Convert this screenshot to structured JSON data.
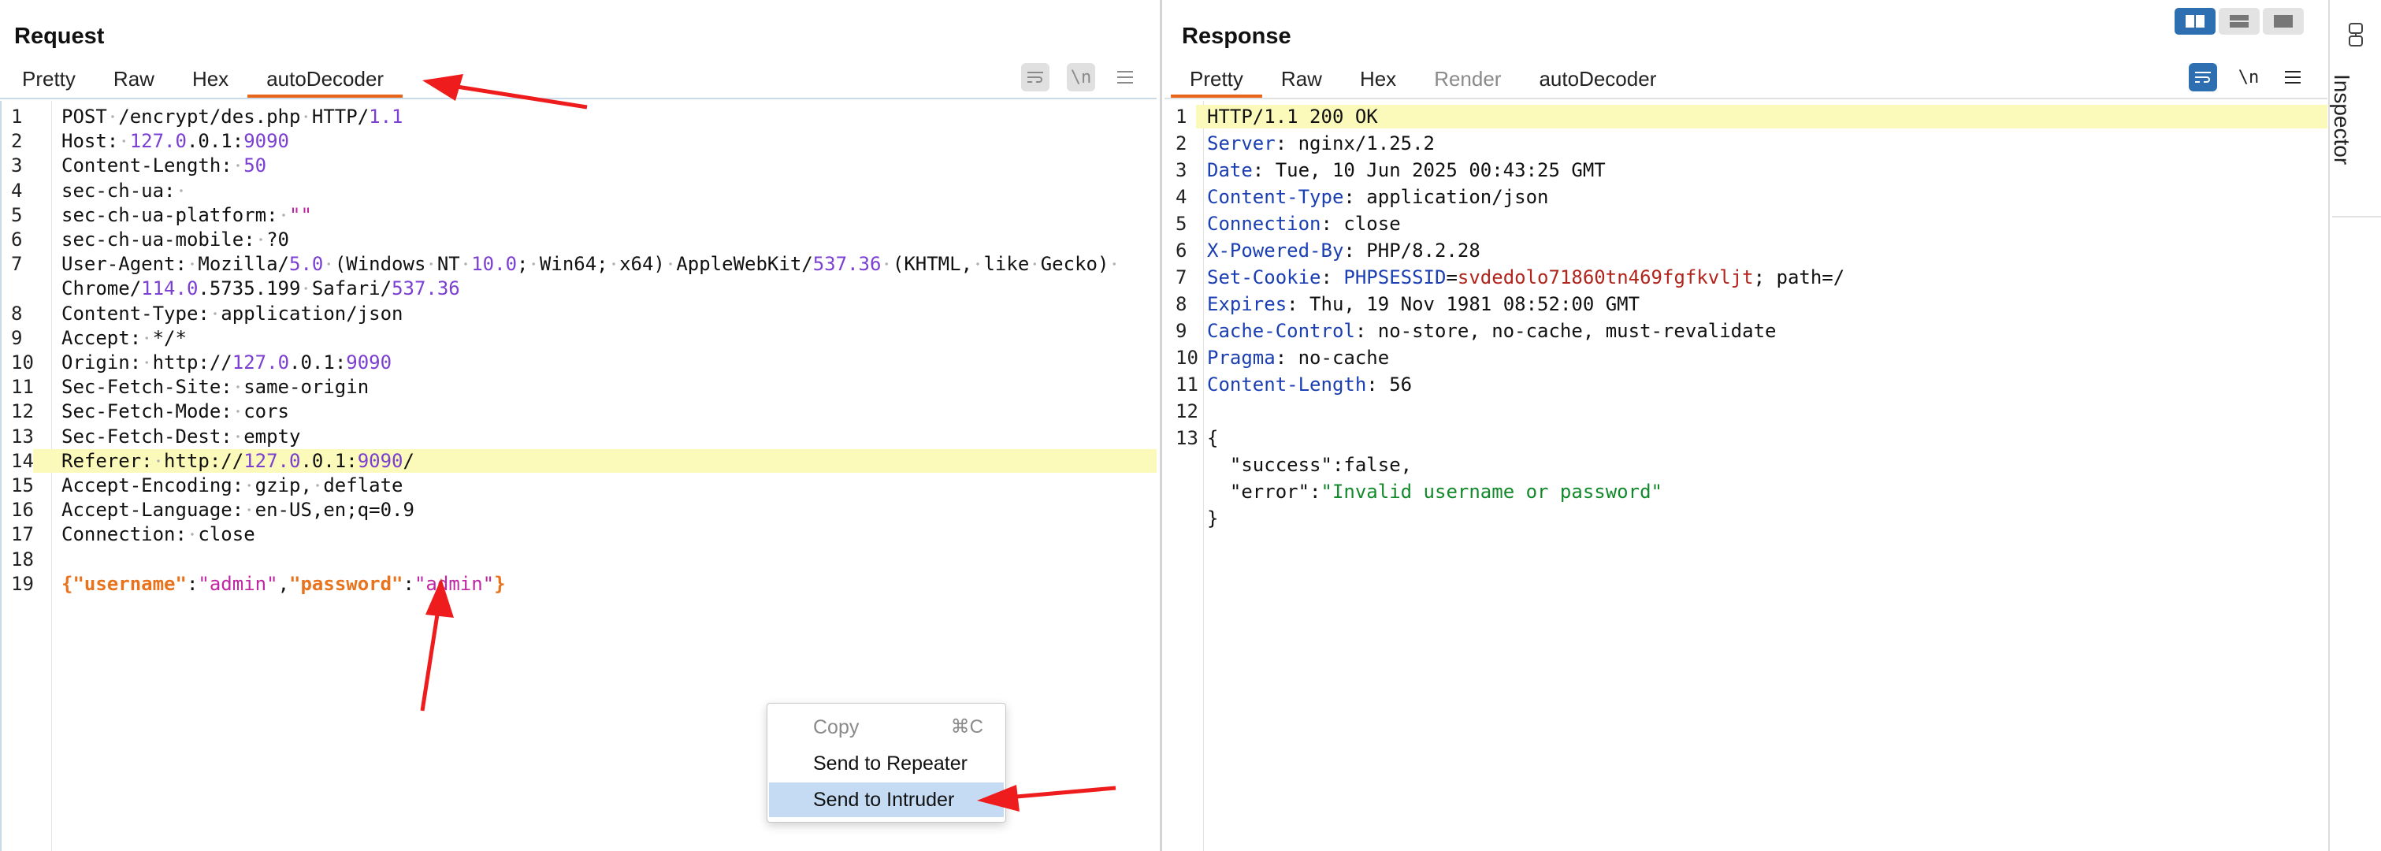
{
  "request": {
    "title": "Request",
    "tabs": [
      "Pretty",
      "Raw",
      "Hex",
      "autoDecoder"
    ],
    "active_tab": "autoDecoder",
    "tools": {
      "wrap_icon": "wrap-lines-icon",
      "newline_label": "\\n",
      "menu_icon": "hamburger-menu-icon"
    },
    "lines": [
      {
        "n": "1",
        "segs": [
          [
            "POST",
            ""
          ],
          [
            " ",
            "dot"
          ],
          [
            "/encrypt/des.php",
            ""
          ],
          [
            " ",
            "dot"
          ],
          [
            "HTTP/",
            ""
          ],
          [
            "1.1",
            "num"
          ]
        ]
      },
      {
        "n": "2",
        "segs": [
          [
            "Host:",
            ""
          ],
          [
            " ",
            "dot"
          ],
          [
            "127.0",
            "num"
          ],
          [
            ".0.1:",
            ""
          ],
          [
            "9090",
            "num"
          ]
        ]
      },
      {
        "n": "3",
        "segs": [
          [
            "Content-Length:",
            ""
          ],
          [
            " ",
            "dot"
          ],
          [
            "50",
            "num"
          ]
        ]
      },
      {
        "n": "4",
        "segs": [
          [
            "sec-ch-ua:",
            ""
          ],
          [
            " ",
            "dot"
          ]
        ]
      },
      {
        "n": "5",
        "segs": [
          [
            "sec-ch-ua-platform:",
            ""
          ],
          [
            " ",
            "dot"
          ],
          [
            "\"\"",
            "str"
          ]
        ]
      },
      {
        "n": "6",
        "segs": [
          [
            "sec-ch-ua-mobile:",
            ""
          ],
          [
            " ",
            "dot"
          ],
          [
            "?0",
            ""
          ]
        ]
      },
      {
        "n": "7",
        "segs": [
          [
            "User-Agent:",
            ""
          ],
          [
            " ",
            "dot"
          ],
          [
            "Mozilla/",
            ""
          ],
          [
            "5.0",
            "num"
          ],
          [
            " ",
            "dot"
          ],
          [
            "(Windows",
            ""
          ],
          [
            " ",
            "dot"
          ],
          [
            "NT",
            ""
          ],
          [
            " ",
            "dot"
          ],
          [
            "10.0",
            "num"
          ],
          [
            ";",
            ""
          ],
          [
            " ",
            "dot"
          ],
          [
            "Win64;",
            ""
          ],
          [
            " ",
            "dot"
          ],
          [
            "x64)",
            ""
          ],
          [
            " ",
            "dot"
          ],
          [
            "AppleWebKit/",
            ""
          ],
          [
            "537.36",
            "num"
          ],
          [
            " ",
            "dot"
          ],
          [
            "(KHTML,",
            ""
          ],
          [
            " ",
            "dot"
          ],
          [
            "like",
            ""
          ],
          [
            " ",
            "dot"
          ],
          [
            "Gecko)",
            ""
          ],
          [
            " ",
            "dot"
          ]
        ]
      },
      {
        "n": "",
        "segs": [
          [
            "Chrome/",
            ""
          ],
          [
            "114.0",
            "num"
          ],
          [
            ".5735.199",
            ""
          ],
          [
            " ",
            "dot"
          ],
          [
            "Safari/",
            ""
          ],
          [
            "537.36",
            "num"
          ]
        ]
      },
      {
        "n": "8",
        "segs": [
          [
            "Content-Type:",
            ""
          ],
          [
            " ",
            "dot"
          ],
          [
            "application/json",
            ""
          ]
        ]
      },
      {
        "n": "9",
        "segs": [
          [
            "Accept:",
            ""
          ],
          [
            " ",
            "dot"
          ],
          [
            "*/*",
            ""
          ]
        ]
      },
      {
        "n": "10",
        "segs": [
          [
            "Origin:",
            ""
          ],
          [
            " ",
            "dot"
          ],
          [
            "http://",
            ""
          ],
          [
            "127.0",
            "num"
          ],
          [
            ".0.1:",
            ""
          ],
          [
            "9090",
            "num"
          ]
        ]
      },
      {
        "n": "11",
        "segs": [
          [
            "Sec-Fetch-Site:",
            ""
          ],
          [
            " ",
            "dot"
          ],
          [
            "same-origin",
            ""
          ]
        ]
      },
      {
        "n": "12",
        "segs": [
          [
            "Sec-Fetch-Mode:",
            ""
          ],
          [
            " ",
            "dot"
          ],
          [
            "cors",
            ""
          ]
        ]
      },
      {
        "n": "13",
        "segs": [
          [
            "Sec-Fetch-Dest:",
            ""
          ],
          [
            " ",
            "dot"
          ],
          [
            "empty",
            ""
          ]
        ]
      },
      {
        "n": "14",
        "hl": true,
        "segs": [
          [
            "Referer:",
            ""
          ],
          [
            " ",
            "dot"
          ],
          [
            "http://",
            ""
          ],
          [
            "127.0",
            "num"
          ],
          [
            ".0.1:",
            ""
          ],
          [
            "9090",
            "num"
          ],
          [
            "/",
            ""
          ]
        ]
      },
      {
        "n": "15",
        "segs": [
          [
            "Accept-Encoding:",
            ""
          ],
          [
            " ",
            "dot"
          ],
          [
            "gzip,",
            ""
          ],
          [
            " ",
            "dot"
          ],
          [
            "deflate",
            ""
          ]
        ]
      },
      {
        "n": "16",
        "segs": [
          [
            "Accept-Language:",
            ""
          ],
          [
            " ",
            "dot"
          ],
          [
            "en-US,en;q=0.9",
            ""
          ]
        ]
      },
      {
        "n": "17",
        "segs": [
          [
            "Connection:",
            ""
          ],
          [
            " ",
            "dot"
          ],
          [
            "close",
            ""
          ]
        ]
      },
      {
        "n": "18",
        "segs": []
      },
      {
        "n": "19",
        "segs": [
          [
            "{",
            "key"
          ],
          [
            "\"username\"",
            "key"
          ],
          [
            ":",
            ""
          ],
          [
            "\"admin\"",
            "str"
          ],
          [
            ",",
            ""
          ],
          [
            "\"password\"",
            "key"
          ],
          [
            ":",
            ""
          ],
          [
            "\"admin\"",
            "str"
          ],
          [
            "}",
            "key"
          ]
        ]
      }
    ]
  },
  "response": {
    "title": "Response",
    "tabs": [
      "Pretty",
      "Raw",
      "Hex",
      "Render",
      "autoDecoder"
    ],
    "active_tab": "Pretty",
    "disabled_tab": "Render",
    "tools": {
      "wrap_icon": "wrap-lines-icon",
      "newline_label": "\\n",
      "menu_icon": "hamburger-menu-icon"
    },
    "lines": [
      {
        "n": "1",
        "hl": true,
        "segs": [
          [
            "HTTP/1.1 200 OK",
            ""
          ]
        ]
      },
      {
        "n": "2",
        "segs": [
          [
            "Server",
            "hk"
          ],
          [
            ": nginx/1.25.2",
            ""
          ]
        ]
      },
      {
        "n": "3",
        "segs": [
          [
            "Date",
            "hk"
          ],
          [
            ": Tue, 10 Jun 2025 00:43:25 GMT",
            ""
          ]
        ]
      },
      {
        "n": "4",
        "segs": [
          [
            "Content-Type",
            "hk"
          ],
          [
            ": application/json",
            ""
          ]
        ]
      },
      {
        "n": "5",
        "segs": [
          [
            "Connection",
            "hk"
          ],
          [
            ": close",
            ""
          ]
        ]
      },
      {
        "n": "6",
        "segs": [
          [
            "X-Powered-By",
            "hk"
          ],
          [
            ": PHP/8.2.28",
            ""
          ]
        ]
      },
      {
        "n": "7",
        "segs": [
          [
            "Set-Cookie",
            "hk"
          ],
          [
            ": ",
            ""
          ],
          [
            "PHPSESSID",
            "hk"
          ],
          [
            "=",
            ""
          ],
          [
            "svdedolo71860tn469fgfkvljt",
            "cookie"
          ],
          [
            "; path=/",
            ""
          ]
        ]
      },
      {
        "n": "8",
        "segs": [
          [
            "Expires",
            "hk"
          ],
          [
            ": Thu, 19 Nov 1981 08:52:00 GMT",
            ""
          ]
        ]
      },
      {
        "n": "9",
        "segs": [
          [
            "Cache-Control",
            "hk"
          ],
          [
            ": no-store, no-cache, must-revalidate",
            ""
          ]
        ]
      },
      {
        "n": "10",
        "segs": [
          [
            "Pragma",
            "hk"
          ],
          [
            ": no-cache",
            ""
          ]
        ]
      },
      {
        "n": "11",
        "segs": [
          [
            "Content-Length",
            "hk"
          ],
          [
            ": 56",
            ""
          ]
        ]
      },
      {
        "n": "12",
        "segs": []
      },
      {
        "n": "13",
        "segs": [
          [
            "{",
            ""
          ]
        ]
      },
      {
        "n": "",
        "segs": [
          [
            "  \"success\":false,",
            ""
          ]
        ]
      },
      {
        "n": "",
        "segs": [
          [
            "  \"error\":",
            ""
          ],
          [
            "\"Invalid username or password\"",
            "green"
          ]
        ]
      },
      {
        "n": "",
        "segs": [
          [
            "}",
            ""
          ]
        ]
      }
    ]
  },
  "context_menu": {
    "items": [
      {
        "label": "Copy",
        "shortcut": "⌘C",
        "disabled": true
      },
      {
        "label": "Send to Repeater",
        "shortcut": ""
      },
      {
        "label": "Send to Intruder",
        "shortcut": "",
        "selected": true
      }
    ]
  },
  "sidebar": {
    "inspector_label": "Inspector",
    "layout_buttons": [
      "split-horizontal-icon",
      "split-vertical-icon",
      "single-pane-icon"
    ]
  },
  "colors": {
    "accent_tab": "#e8661c",
    "toggle_on": "#2d6fb0",
    "arrow_red": "#ee1c1c",
    "highlight_line": "#fbfaba",
    "menu_selected": "#c4dbf3"
  }
}
